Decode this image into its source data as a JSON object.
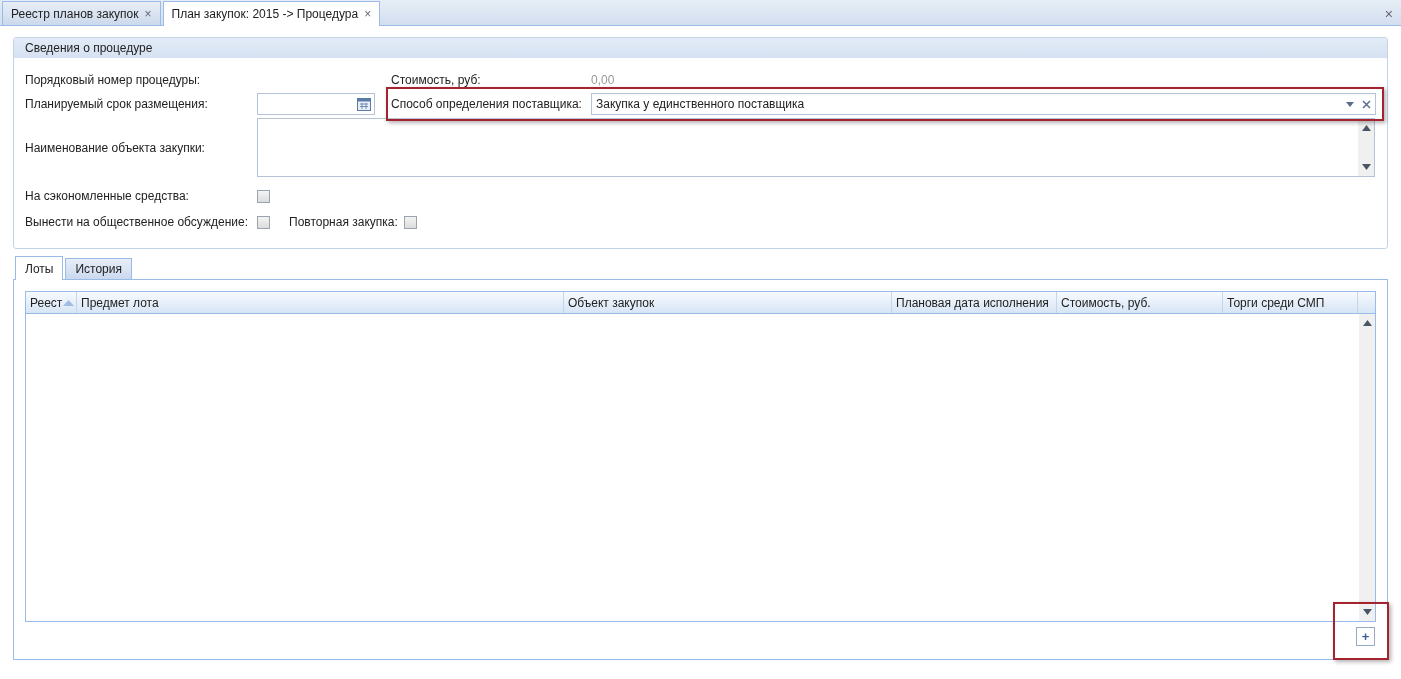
{
  "tabs": [
    {
      "label": "Реестр планов закупок",
      "close": "×",
      "selected": false
    },
    {
      "label": "План закупок: 2015 -> Процедура",
      "close": "×",
      "selected": true
    }
  ],
  "window_close": "×",
  "panel": {
    "title": "Сведения о процедуре",
    "number_label": "Порядковый номер процедуры:",
    "cost_label": "Стоимость, руб:",
    "cost_value": "0,00",
    "term_label": "Планируемый срок размещения:",
    "method_label": "Способ определения поставщика:",
    "method_value": "Закупка у единственного поставщика",
    "method_highlighted": true,
    "name_label": "Наименование объекта закупки:",
    "checkboxes": [
      {
        "label": "На сэкономленные средства:",
        "checked": false
      },
      {
        "label": "Вынести на общественное обсуждение:",
        "checked": false
      },
      {
        "label": "Повторная закупка:",
        "checked": false
      }
    ]
  },
  "lower_tabs": [
    {
      "label": "Лоты",
      "selected": true
    },
    {
      "label": "История",
      "selected": false
    }
  ],
  "table": {
    "columns": [
      {
        "label": "Реест",
        "sorted": true
      },
      {
        "label": "Предмет лота",
        "sorted": false
      },
      {
        "label": "Объект закупок",
        "sorted": false
      },
      {
        "label": "Плановая дата исполнения",
        "sorted": false
      },
      {
        "label": "Стоимость, руб.",
        "sorted": false
      },
      {
        "label": "Торги среди СМП",
        "sorted": false
      }
    ]
  },
  "add_button": {
    "label": "+",
    "highlighted": true
  }
}
